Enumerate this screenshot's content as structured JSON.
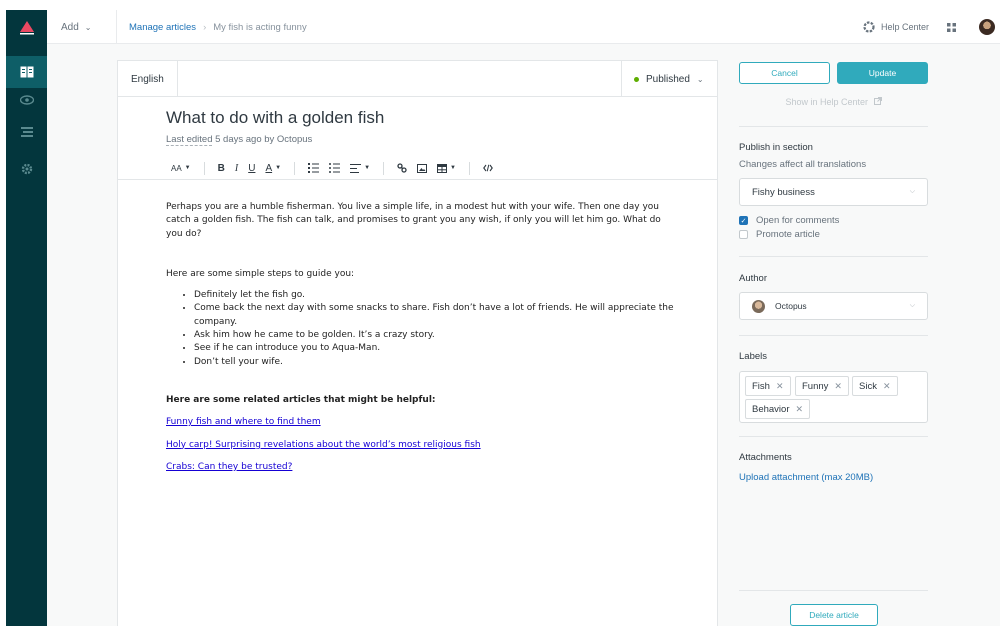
{
  "topbar": {
    "add_label": "Add",
    "breadcrumb_link": "Manage articles",
    "breadcrumb_separator": "›",
    "breadcrumb_current": "My fish is acting funny",
    "help_center_label": "Help Center"
  },
  "nav": {
    "items": [
      "guide-icon",
      "eye-icon",
      "list-icon",
      "gear-icon"
    ]
  },
  "editor": {
    "language_tab": "English",
    "status": "Published",
    "status_color": "#5eae00",
    "title": "What to do with a golden fish",
    "last_edited_label": "Last edited",
    "last_edited_rest": " 5 days ago by Octopus",
    "toolbar": {
      "font_size": "AA",
      "bold": "B",
      "italic": "I",
      "underline": "U",
      "color": "A"
    },
    "paragraph1": "Perhaps you are a humble fisherman. You live a simple life, in a modest hut with your wife. Then one day you catch a golden fish. The fish can talk, and promises to grant you any wish, if only you will let him go. What do you do?",
    "paragraph2": "Here are some simple steps to guide you:",
    "steps": [
      "Definitely let the fish go.",
      "Come back the next day with some snacks to share. Fish don’t have a lot of friends. He will appreciate the company.",
      "Ask him how he came to be golden. It’s a crazy story.",
      "See if he can introduce you to Aqua-Man.",
      "Don’t tell your wife."
    ],
    "related_heading": "Here are some related articles that might be helpful:",
    "related_links": [
      "Funny fish and where to find them",
      "Holy carp! Surprising revelations about the world’s most religious fish",
      "Crabs: Can they be trusted?"
    ]
  },
  "sidebar": {
    "cancel_label": "Cancel",
    "update_label": "Update",
    "show_in_help_center": "Show in Help Center",
    "publish_title": "Publish in section",
    "publish_subtitle": "Changes affect all translations",
    "section_value": "Fishy business",
    "open_for_comments": "Open for comments",
    "open_for_comments_checked": true,
    "promote_article": "Promote article",
    "promote_article_checked": false,
    "author_title": "Author",
    "author_value": "Octopus",
    "labels_title": "Labels",
    "labels": [
      "Fish",
      "Funny",
      "Sick",
      "Behavior"
    ],
    "attachments_title": "Attachments",
    "upload_label": "Upload attachment (max 20MB)",
    "delete_label": "Delete article"
  },
  "colors": {
    "nav_bg": "#03363d",
    "accent": "#30aabc",
    "link": "#1f73b7"
  }
}
